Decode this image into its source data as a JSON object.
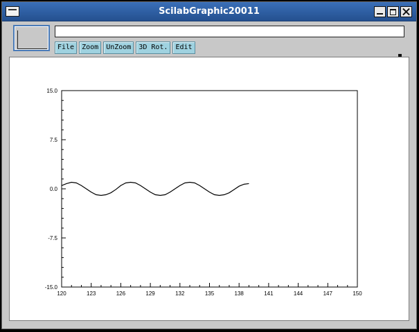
{
  "window": {
    "title": "ScilabGraphic20011"
  },
  "message_field": {
    "value": ""
  },
  "menu": [
    {
      "label": "File"
    },
    {
      "label": "Zoom"
    },
    {
      "label": "UnZoom"
    },
    {
      "label": "3D Rot."
    },
    {
      "label": "Edit"
    }
  ],
  "chart_data": {
    "type": "line",
    "title": "",
    "xlabel": "",
    "ylabel": "",
    "xlim": [
      120,
      150
    ],
    "ylim": [
      -15,
      15
    ],
    "x_ticks": [
      "120",
      "123",
      "126",
      "129",
      "132",
      "135",
      "138",
      "141",
      "144",
      "147",
      "150"
    ],
    "y_ticks": [
      "15.0",
      "7.5",
      "0.0",
      "-7.5",
      "-15.0"
    ],
    "grid": false,
    "series": [
      {
        "color": "#000000",
        "x": [
          120,
          120.5,
          121,
          121.5,
          122,
          122.5,
          123,
          123.5,
          124,
          124.5,
          125,
          125.5,
          126,
          126.5,
          127,
          127.5,
          128,
          128.5,
          129,
          129.5,
          130,
          130.5,
          131,
          131.5,
          132,
          132.5,
          133,
          133.5,
          134,
          134.5,
          135,
          135.5,
          136,
          136.5,
          137,
          137.5,
          138,
          138.5,
          139
        ],
        "y": [
          0.5,
          0.8,
          1.0,
          0.9,
          0.5,
          -0.0,
          -0.5,
          -0.9,
          -1.0,
          -0.9,
          -0.6,
          -0.1,
          0.5,
          0.9,
          1.0,
          0.9,
          0.5,
          0.0,
          -0.5,
          -0.9,
          -1.0,
          -0.9,
          -0.5,
          0.0,
          0.5,
          0.9,
          1.0,
          0.9,
          0.5,
          0.0,
          -0.5,
          -0.9,
          -1.0,
          -0.9,
          -0.6,
          -0.1,
          0.4,
          0.7,
          0.8
        ]
      }
    ]
  }
}
